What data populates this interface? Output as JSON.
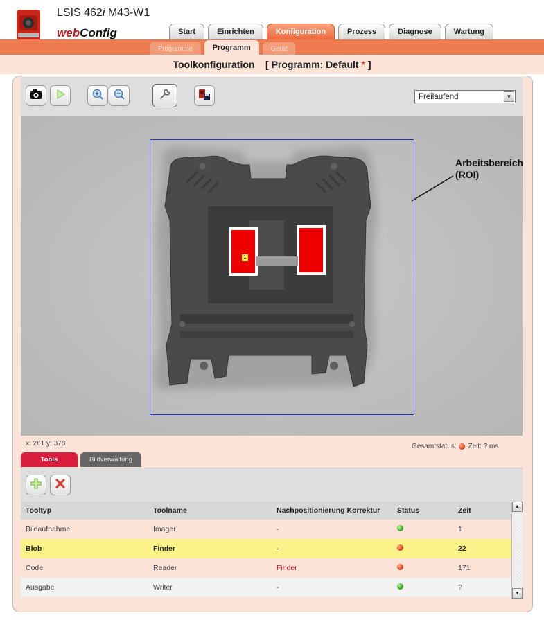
{
  "header": {
    "product_prefix": "LSIS 462",
    "product_italic": "i",
    "product_suffix": " M43-W1",
    "brand_web": "web",
    "brand_config": "Config"
  },
  "main_tabs": [
    {
      "label": "Start",
      "active": false
    },
    {
      "label": "Einrichten",
      "active": false
    },
    {
      "label": "Konfiguration",
      "active": true
    },
    {
      "label": "Prozess",
      "active": false
    },
    {
      "label": "Diagnose",
      "active": false
    },
    {
      "label": "Wartung",
      "active": false
    }
  ],
  "sub_tabs": [
    {
      "label": "Programme",
      "active": false
    },
    {
      "label": "Programm",
      "active": true
    },
    {
      "label": "Gerät",
      "active": false
    }
  ],
  "title": {
    "main": "Toolkonfiguration",
    "program": "[ Programm: Default",
    "star": "*",
    "close": "]"
  },
  "toolbar": {
    "icons": [
      "camera-icon",
      "play-icon",
      "zoom-in-icon",
      "zoom-out-icon",
      "wrench-icon",
      "save-to-device-icon"
    ],
    "mode": "Freilaufend"
  },
  "image": {
    "roi_label_line1": "Arbeitsbereich",
    "roi_label_line2": "(ROI)",
    "blob_marker": "1"
  },
  "statusbar": {
    "coord": "x: 261 y: 378",
    "gesamt_label": "Gesamtstatus:",
    "time": "Zeit: ? ms",
    "status_color": "red"
  },
  "lower_tabs": [
    {
      "label": "Tools",
      "active": true
    },
    {
      "label": "Bildverwaltung",
      "active": false
    }
  ],
  "table": {
    "headers": [
      "Tooltyp",
      "Toolname",
      "Nachpositionierung Korrektur",
      "Status",
      "Zeit"
    ],
    "rows": [
      {
        "type": "Bildaufnahme",
        "name": "Imager",
        "nachpos": "-",
        "status": "green",
        "time": "1"
      },
      {
        "type": "Blob",
        "name": "Finder",
        "nachpos": "-",
        "status": "red",
        "time": "22"
      },
      {
        "type": "Code",
        "name": "Reader",
        "nachpos": "Finder",
        "status": "red",
        "time": "171"
      },
      {
        "type": "Ausgabe",
        "name": "Writer",
        "nachpos": "-",
        "status": "green",
        "time": "?"
      }
    ]
  },
  "colors": {
    "accent_orange": "#ee7b50",
    "accent_red": "#d81e3c",
    "roi_blue": "#2233cc",
    "selected_row": "#fcf28a"
  }
}
